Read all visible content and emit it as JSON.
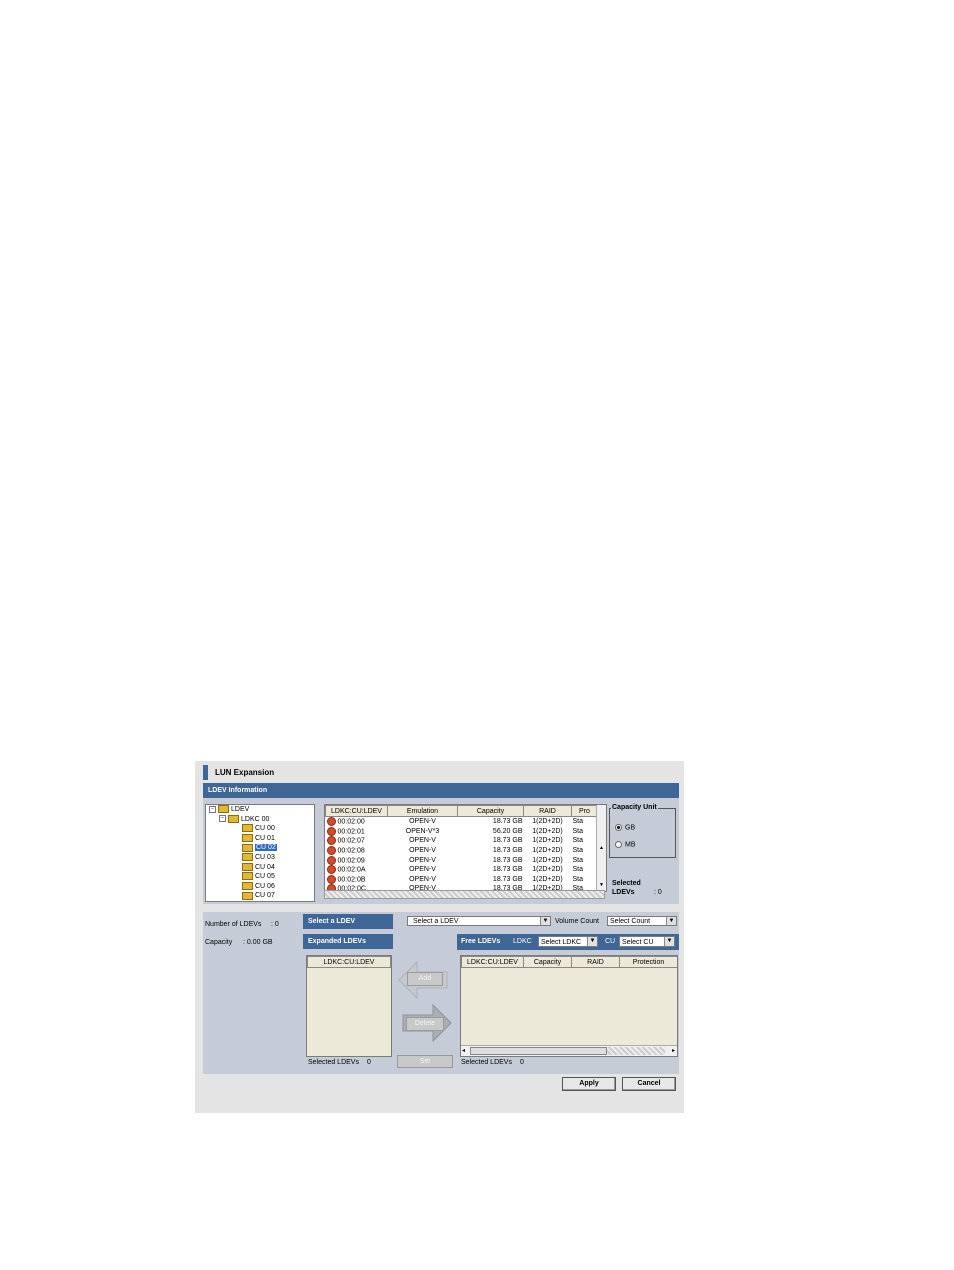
{
  "window": {
    "title": "LUN Expansion",
    "ldev_info_bar": "LDEV Information"
  },
  "tree": {
    "items": [
      {
        "label": "LDEV",
        "expander": "−"
      },
      {
        "label": "LDKC 00",
        "expander": "−"
      },
      {
        "label": "CU 00"
      },
      {
        "label": "CU 01"
      },
      {
        "label": "CU 02",
        "selected": true
      },
      {
        "label": "CU 03"
      },
      {
        "label": "CU 04"
      },
      {
        "label": "CU 05"
      },
      {
        "label": "CU 06"
      },
      {
        "label": "CU 07"
      }
    ]
  },
  "ldev_table": {
    "headers": [
      "LDKC:CU:LDEV",
      "Emulation",
      "Capacity",
      "RAID",
      "Pro"
    ],
    "rows": [
      [
        "00:02:00",
        "OPEN-V",
        "18.73 GB",
        "1(2D+2D)",
        "Sta"
      ],
      [
        "00:02:01",
        "OPEN-V*3",
        "56.20 GB",
        "1(2D+2D)",
        "Sta"
      ],
      [
        "00:02:07",
        "OPEN-V",
        "18.73 GB",
        "1(2D+2D)",
        "Sta"
      ],
      [
        "00:02:08",
        "OPEN-V",
        "18.73 GB",
        "1(2D+2D)",
        "Sta"
      ],
      [
        "00:02:09",
        "OPEN-V",
        "18.73 GB",
        "1(2D+2D)",
        "Sta"
      ],
      [
        "00:02:0A",
        "OPEN-V",
        "18.73 GB",
        "1(2D+2D)",
        "Sta"
      ],
      [
        "00:02:0B",
        "OPEN-V",
        "18.73 GB",
        "1(2D+2D)",
        "Sta"
      ],
      [
        "00:02:0C",
        "OPEN-V",
        "18.73 GB",
        "1(2D+2D)",
        "Sta"
      ]
    ]
  },
  "capacity_unit": {
    "legend": "Capacity Unit",
    "options": [
      "GB",
      "MB"
    ],
    "selected": "GB"
  },
  "selected_ldevs_top": {
    "label1": "Selected",
    "label2": "LDEVs",
    "value": ": 0"
  },
  "summary": {
    "num_ldevs_label": "Number of LDEVs",
    "num_ldevs_value": ": 0",
    "capacity_label": "Capacity",
    "capacity_value": ": 0.00 GB"
  },
  "select_ldev": {
    "bar": "Select a LDEV",
    "dropdown": "Select a LDEV",
    "volume_count_label": "Volume Count",
    "volume_count_dropdown": "Select Count"
  },
  "expanded": {
    "bar": "Expanded LDEVs",
    "header": "LDKC:CU:LDEV",
    "selected_label": "Selected LDEVs",
    "selected_value": "0"
  },
  "free": {
    "bar": "Free LDEVs",
    "ldkc_label": "LDKC",
    "ldkc_dropdown": "Select LDKC",
    "cu_label": "CU",
    "cu_dropdown": "Select CU",
    "headers": [
      "LDKC:CU:LDEV",
      "Capacity",
      "RAID",
      "Protection"
    ],
    "selected_label": "Selected LDEVs",
    "selected_value": "0"
  },
  "buttons": {
    "add": "Add",
    "delete": "Delete",
    "set": "Set",
    "apply": "Apply",
    "cancel": "Cancel"
  },
  "colors": {
    "bar_blue": "#3e6797",
    "panel": "#c6cbd8",
    "window": "#e4e4e4"
  }
}
